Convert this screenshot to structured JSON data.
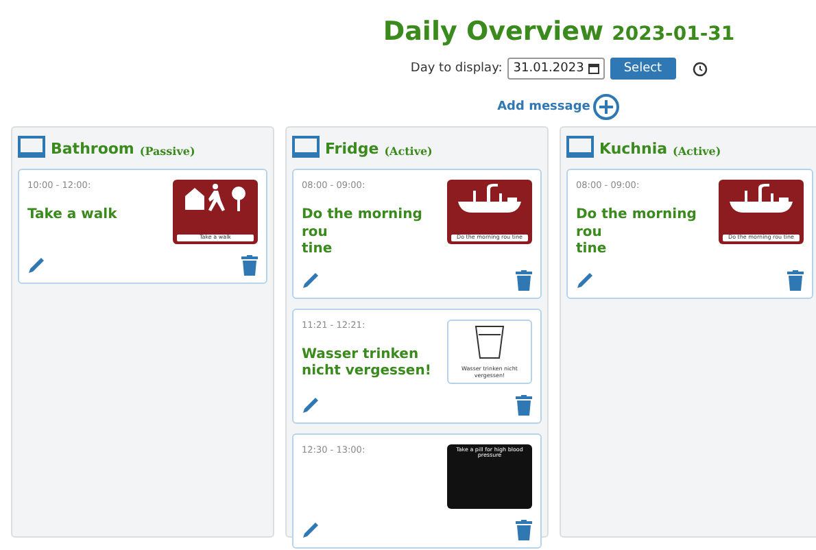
{
  "header": {
    "title": "Daily Overview",
    "date": "2023-01-31",
    "day_label": "Day to display:",
    "day_value": "31.01.2023",
    "select_button": "Select",
    "add_message": "Add message"
  },
  "devices": [
    {
      "name": "Bathroom",
      "status": "(Passive)",
      "messages": [
        {
          "time": "10:00 - 12:00:",
          "title": "Take a walk",
          "pictogram": {
            "kind": "walk",
            "caption": "Take a walk"
          }
        }
      ]
    },
    {
      "name": "Fridge",
      "status": "(Active)",
      "messages": [
        {
          "time": "08:00 - 09:00:",
          "title": "Do the morning rou\ntine",
          "pictogram": {
            "kind": "sink",
            "caption": "Do the morning rou tine"
          }
        },
        {
          "time": "11:21 - 12:21:",
          "title": "Wasser trinken nicht vergessen!",
          "pictogram": {
            "kind": "glass",
            "caption": "Wasser trinken nicht vergessen!"
          }
        },
        {
          "time": "12:30 - 13:00:",
          "pictogram": {
            "kind": "pill",
            "caption": "Take a pill for high blood pressure"
          }
        }
      ]
    },
    {
      "name": "Kuchnia",
      "status": "(Active)",
      "messages": [
        {
          "time": "08:00 - 09:00:",
          "title": "Do the morning rou\ntine",
          "pictogram": {
            "kind": "sink",
            "caption": "Do the morning rou tine"
          }
        }
      ]
    }
  ]
}
